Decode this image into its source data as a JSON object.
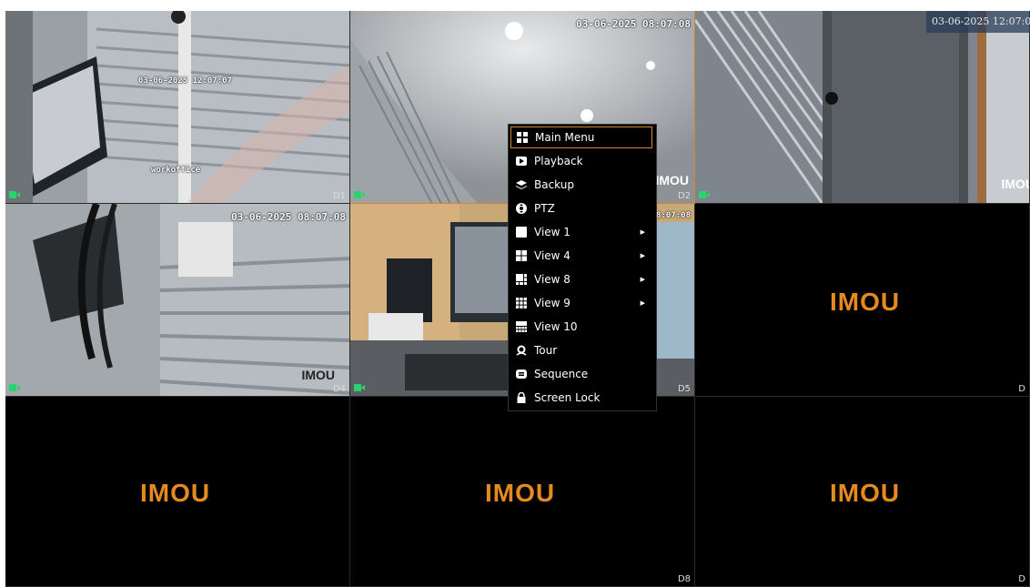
{
  "system_clock": "03-06-2025 12:07:08",
  "brand": "IMOU",
  "colors": {
    "accent": "#d4862a",
    "brand": "#e48a1f",
    "background": "#000000"
  },
  "cells": [
    {
      "channel": "D1",
      "timestamp": "03-06-2025 12:07:07",
      "caption": "workoffice",
      "recording": true
    },
    {
      "channel": "D2",
      "timestamp": "03-06-2025 08:07:08",
      "caption": "",
      "recording": true
    },
    {
      "channel": "D3",
      "timestamp": "",
      "caption": "",
      "recording": true
    },
    {
      "channel": "D4",
      "timestamp": "03-06-2025 08:07:08",
      "caption": "",
      "recording": true
    },
    {
      "channel": "D5",
      "timestamp": "08:07:08",
      "caption": "",
      "recording": true
    },
    {
      "channel": "D",
      "timestamp": "",
      "caption": "",
      "recording": false
    },
    {
      "channel": "",
      "timestamp": "",
      "caption": "",
      "recording": false
    },
    {
      "channel": "D7",
      "timestamp": "",
      "caption": "",
      "recording": false
    },
    {
      "channel": "D8",
      "timestamp": "",
      "caption": "",
      "recording": false
    },
    {
      "channel": "D",
      "timestamp": "",
      "caption": "",
      "recording": false
    }
  ],
  "context_menu": {
    "items": [
      {
        "label": "Main Menu",
        "icon": "grid-4-icon",
        "submenu": false,
        "active": true
      },
      {
        "label": "Playback",
        "icon": "play-icon",
        "submenu": false,
        "active": false
      },
      {
        "label": "Backup",
        "icon": "layers-icon",
        "submenu": false,
        "active": false
      },
      {
        "label": "PTZ",
        "icon": "ptz-icon",
        "submenu": false,
        "active": false
      },
      {
        "label": "View 1",
        "icon": "view-1-icon",
        "submenu": true,
        "active": false
      },
      {
        "label": "View 4",
        "icon": "view-4-icon",
        "submenu": true,
        "active": false
      },
      {
        "label": "View 8",
        "icon": "view-8-icon",
        "submenu": true,
        "active": false
      },
      {
        "label": "View 9",
        "icon": "view-9-icon",
        "submenu": true,
        "active": false
      },
      {
        "label": "View 10",
        "icon": "view-10-icon",
        "submenu": false,
        "active": false
      },
      {
        "label": "Tour",
        "icon": "tour-icon",
        "submenu": false,
        "active": false
      },
      {
        "label": "Sequence",
        "icon": "sequence-icon",
        "submenu": false,
        "active": false
      },
      {
        "label": "Screen Lock",
        "icon": "lock-icon",
        "submenu": false,
        "active": false
      }
    ]
  }
}
